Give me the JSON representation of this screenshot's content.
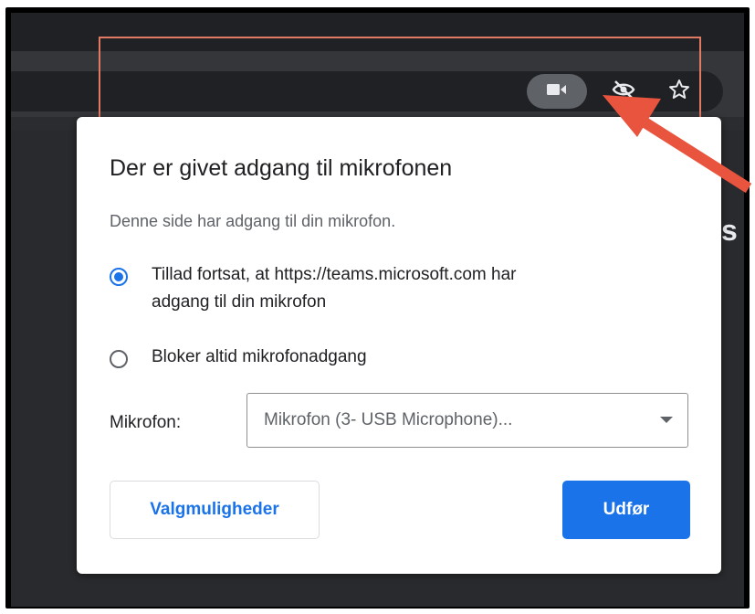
{
  "browser": {
    "toolbar_icons": [
      "video-camera-icon",
      "eye-off-icon",
      "star-icon"
    ],
    "page_edge_char": "s"
  },
  "dialog": {
    "title": "Der er givet adgang til mikrofonen",
    "description": "Denne side har adgang til din mikrofon.",
    "options": [
      {
        "label_line1": "Tillad fortsat, at https://teams.microsoft.com har",
        "label_line2": "adgang til din mikrofon",
        "checked": true
      },
      {
        "label_line1": "Bloker altid mikrofonadgang",
        "checked": false
      }
    ],
    "microphone_label": "Mikrofon:",
    "microphone_selected": "Mikrofon (3- USB Microphone)...",
    "options_button": "Valgmuligheder",
    "done_button": "Udfør"
  },
  "colors": {
    "accent": "#1a73e8",
    "highlight": "#e07a63",
    "arrow": "#e8543e"
  }
}
